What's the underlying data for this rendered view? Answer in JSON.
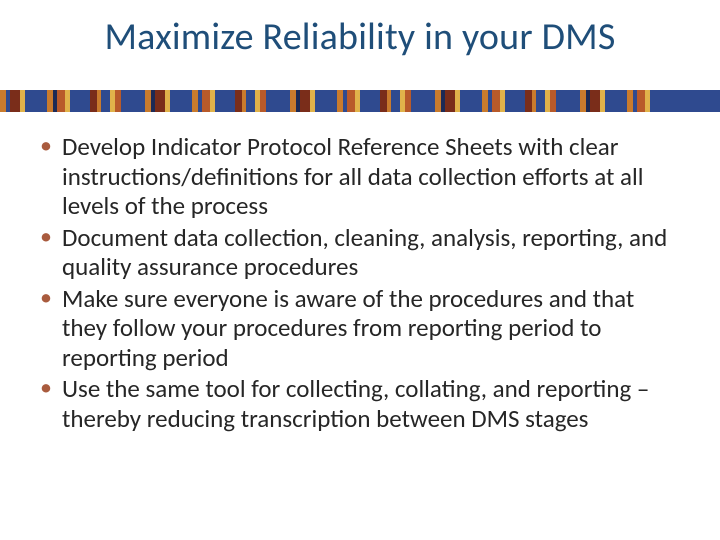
{
  "title": "Maximize Reliability in your DMS",
  "bullets": [
    "Develop Indicator Protocol Reference Sheets with clear instructions/definitions for all data collection efforts at all levels of the process",
    "Document data collection, cleaning, analysis, reporting, and quality assurance procedures",
    "Make sure everyone is aware of the procedures and that they follow your procedures from reporting period to reporting period",
    "Use the same tool for collecting, collating, and reporting – thereby reducing transcription between DMS stages"
  ],
  "colors": {
    "title": "#1f4e79",
    "bullet_marker": "#a95b3e",
    "band_base": "#2f4a8f"
  }
}
